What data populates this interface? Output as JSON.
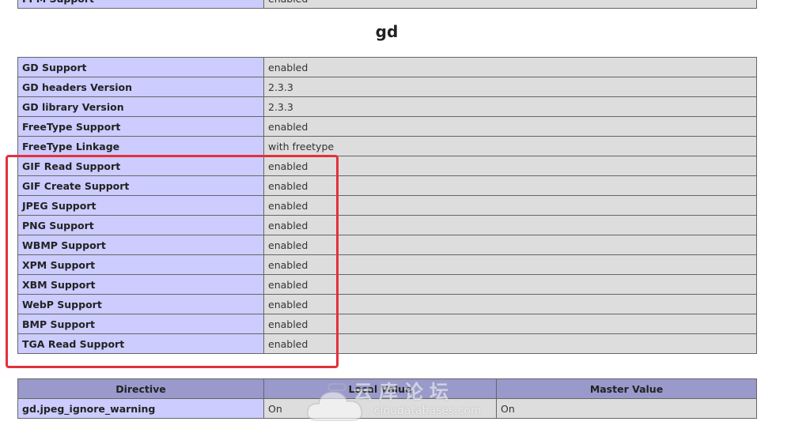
{
  "top_row": {
    "label": "FPM Support",
    "value": "enabled"
  },
  "section_title": "gd",
  "gd_rows": [
    {
      "label": "GD Support",
      "value": "enabled"
    },
    {
      "label": "GD headers Version",
      "value": "2.3.3"
    },
    {
      "label": "GD library Version",
      "value": "2.3.3"
    },
    {
      "label": "FreeType Support",
      "value": "enabled"
    },
    {
      "label": "FreeType Linkage",
      "value": "with freetype"
    },
    {
      "label": "GIF Read Support",
      "value": "enabled"
    },
    {
      "label": "GIF Create Support",
      "value": "enabled"
    },
    {
      "label": "JPEG Support",
      "value": "enabled"
    },
    {
      "label": "PNG Support",
      "value": "enabled"
    },
    {
      "label": "WBMP Support",
      "value": "enabled"
    },
    {
      "label": "XPM Support",
      "value": "enabled"
    },
    {
      "label": "XBM Support",
      "value": "enabled"
    },
    {
      "label": "WebP Support",
      "value": "enabled"
    },
    {
      "label": "BMP Support",
      "value": "enabled"
    },
    {
      "label": "TGA Read Support",
      "value": "enabled"
    }
  ],
  "directives": {
    "headers": {
      "directive": "Directive",
      "local": "Local Value",
      "master": "Master Value"
    },
    "rows": [
      {
        "name": "gd.jpeg_ignore_warning",
        "local": "On",
        "master": "On"
      }
    ]
  },
  "watermark": {
    "title": "云库论坛",
    "url": "cloudatabases.com"
  },
  "colors": {
    "label_bg": "#ccccff",
    "value_bg": "#dddddd",
    "header_bg": "#9999cc",
    "highlight": "#e3313a"
  }
}
